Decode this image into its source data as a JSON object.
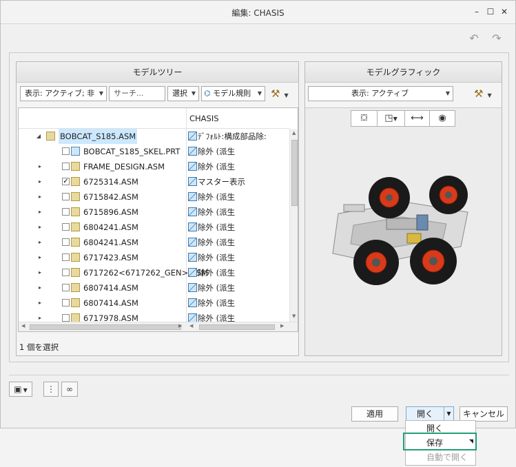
{
  "window": {
    "title": "編集: CHASIS"
  },
  "model_tree": {
    "header": "モデルツリー",
    "display_filter": "表示: アクティブ; 非",
    "search_placeholder": "サーチ...",
    "select_label": "選択",
    "model_rules_label": "モデル規則",
    "column_header": "CHASIS",
    "rows": [
      {
        "name": "BOBCAT_S185.ASM",
        "status": "ﾃﾞﾌｫﾙﾄ:構成部品除:",
        "expander": "◢",
        "checked": null,
        "selected": true
      },
      {
        "name": "BOBCAT_S185_SKEL.PRT",
        "status": "除外 (派生",
        "expander": "",
        "checked": false
      },
      {
        "name": "FRAME_DESIGN.ASM",
        "status": "除外 (派生",
        "expander": "▸",
        "checked": false
      },
      {
        "name": "6725314.ASM",
        "status": "マスター表示",
        "expander": "▸",
        "checked": true
      },
      {
        "name": "6715842.ASM",
        "status": "除外 (派生",
        "expander": "▸",
        "checked": false
      },
      {
        "name": "6715896.ASM",
        "status": "除外 (派生",
        "expander": "▸",
        "checked": false
      },
      {
        "name": "6804241.ASM",
        "status": "除外 (派生",
        "expander": "▸",
        "checked": false
      },
      {
        "name": "6804241.ASM",
        "status": "除外 (派生",
        "expander": "▸",
        "checked": false
      },
      {
        "name": "6717423.ASM",
        "status": "除外 (派生",
        "expander": "▸",
        "checked": false
      },
      {
        "name": "6717262<6717262_GEN>.ASM",
        "status": "除外 (派生",
        "expander": "▸",
        "checked": false
      },
      {
        "name": "6807414.ASM",
        "status": "除外 (派生",
        "expander": "▸",
        "checked": false
      },
      {
        "name": "6807414.ASM",
        "status": "除外 (派生",
        "expander": "▸",
        "checked": false
      },
      {
        "name": "6717978.ASM",
        "status": "除外 (派生",
        "expander": "▸",
        "checked": false
      }
    ],
    "status_text": "1 個を選択"
  },
  "model_graphics": {
    "header": "モデルグラフィック",
    "display_filter": "表示: アクティブ"
  },
  "buttons": {
    "apply": "適用",
    "open": "開く",
    "cancel": "キャンセル"
  },
  "open_menu": {
    "items": [
      {
        "label": "開く",
        "enabled": true
      },
      {
        "label": "保存",
        "enabled": true,
        "highlighted": true
      },
      {
        "label": "自動で開く",
        "enabled": false
      }
    ]
  },
  "colors": {
    "selection": "#cce8ff",
    "highlight_border": "#1ea07a",
    "wheel_red": "#d83a1a"
  }
}
